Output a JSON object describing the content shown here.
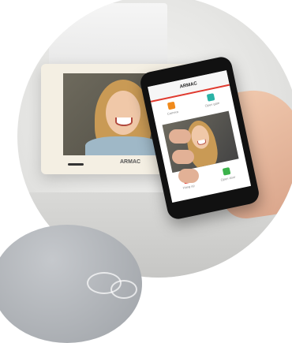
{
  "monitor": {
    "brand": "ARMAC"
  },
  "phone": {
    "app_title": "ARMAC",
    "top_buttons": [
      {
        "label": "Camera",
        "icon": "door-icon",
        "color": "#f08a1c"
      },
      {
        "label": "Open gate",
        "icon": "gate-icon",
        "color": "#2ab3a6"
      }
    ],
    "bottom_buttons": [
      {
        "label": "Hang up",
        "icon": "phone-hangup-icon",
        "color": "#e03a2f"
      },
      {
        "label": "Open door",
        "icon": "door-open-icon",
        "color": "#3bb24a"
      }
    ]
  },
  "colors": {
    "accent": "#e03a2f",
    "background": "#e7e7e5"
  }
}
